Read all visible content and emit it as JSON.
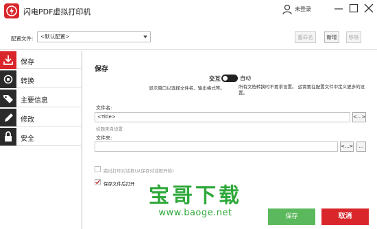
{
  "app": {
    "title": "闪电PDF虚拟打印机",
    "user_label": "未登录"
  },
  "config": {
    "label": "配置文件:",
    "selected": "<默认配置>",
    "rename_label": "重命名",
    "new_label": "新增",
    "remove_label": "移除"
  },
  "sidebar": {
    "items": [
      {
        "label": "保存",
        "icon": "download-icon",
        "active": true
      },
      {
        "label": "转换",
        "icon": "convert-icon",
        "active": false
      },
      {
        "label": "主要信息",
        "icon": "tag-icon",
        "active": false
      },
      {
        "label": "修改",
        "icon": "pencil-icon",
        "active": false
      },
      {
        "label": "安全",
        "icon": "lock-icon",
        "active": false
      }
    ]
  },
  "main": {
    "section_title": "保存",
    "mode": {
      "left_label": "交互",
      "right_label": "自动",
      "left_desc": "显示窗口以选择文件名、输出格式等。",
      "right_desc": "所有文档转换时不要求设置。 运需要在配置文件中定义更多的设置。"
    },
    "filename_label": "文件名:",
    "filename_value": "<Title>",
    "filename_btn": "<...>",
    "filename_hint": "标题来自设置",
    "folder_label": "文件夹:",
    "folder_value": "",
    "folder_btn": "<...>",
    "folder_browse": "...",
    "skip_dialog_label": "跳过打印对话框(从保存对话框开始)",
    "open_after_label": "保存文件后打开",
    "save_button": "保存",
    "cancel_button": "取消"
  },
  "watermark": {
    "title": "宝哥下载",
    "url": "www.baoge.net"
  },
  "colors": {
    "accent_red": "#d9262a",
    "save_green": "#5cb85c",
    "watermark_green": "#2fa83a"
  }
}
